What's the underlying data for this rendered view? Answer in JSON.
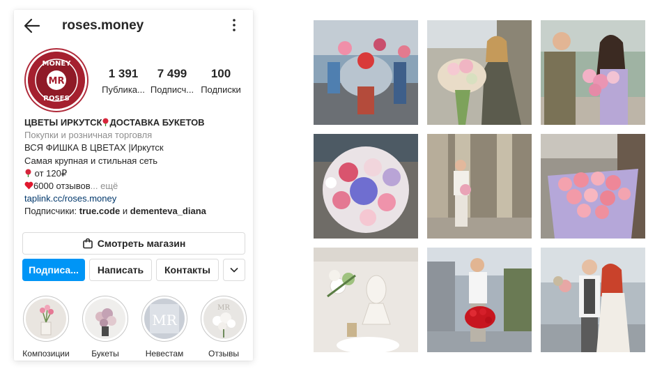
{
  "profile": {
    "username": "roses.money",
    "avatar_logo_top": "MONEY",
    "avatar_logo_mid": "MR",
    "avatar_logo_bottom": "ROSES"
  },
  "stats": [
    {
      "value": "1 391",
      "label": "Публика..."
    },
    {
      "value": "7 499",
      "label": "Подписч..."
    },
    {
      "value": "100",
      "label": "Подписки"
    }
  ],
  "bio": {
    "name_a": "ЦВЕТЫ ИРКУТСК",
    "name_b": "ДОСТАВКА БУКЕТОВ",
    "category": "Покупки и розничная торговля",
    "line1": "ВСЯ ФИШКА В ЦВЕТАХ |Иркутск",
    "line2": "Самая крупная и стильная сеть",
    "line3": "от 120₽",
    "line4": "6000 отзывов",
    "more": "... ещё",
    "link": "taplink.cc/roses.money",
    "followers_prefix": "Подписчики: ",
    "follower1": "true.code",
    "followers_and": " и ",
    "follower2": "dementeva_diana"
  },
  "buttons": {
    "shop": "Смотреть магазин",
    "follow": "Подписа...",
    "message": "Написать",
    "contacts": "Контакты"
  },
  "highlights": [
    {
      "label": "Композиции"
    },
    {
      "label": "Букеты"
    },
    {
      "label": "Невестам"
    },
    {
      "label": "Отзывы"
    }
  ],
  "colors": {
    "accent": "#0095f6",
    "brand": "#a5202f",
    "link": "#00376b",
    "muted": "#8e8e8e"
  }
}
